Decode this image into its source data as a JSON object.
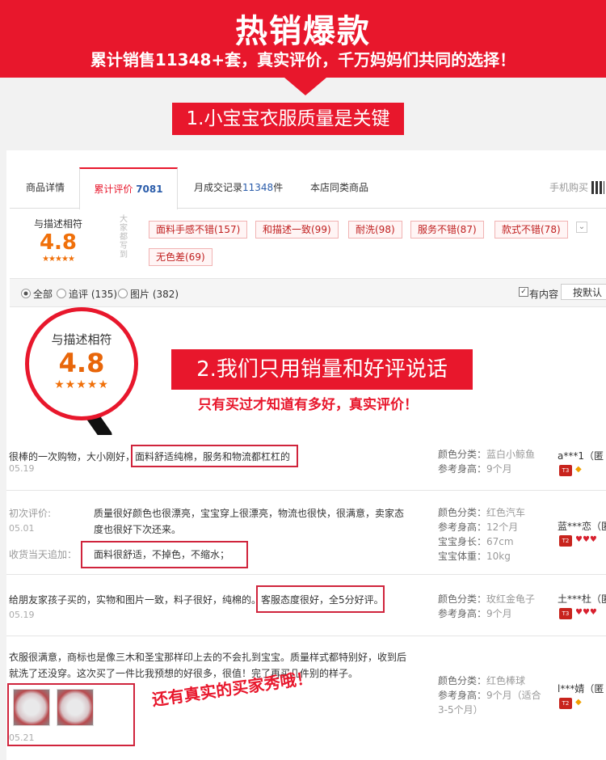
{
  "banner": {
    "title": "热销爆款",
    "subtitle": "累计销售11348+套，真实评价，千万妈妈们共同的选择！"
  },
  "section1": {
    "label": "1.小宝宝衣服质量是关键"
  },
  "tabs": [
    {
      "label": "商品详情"
    },
    {
      "label": "累计评价 ",
      "count": "7081"
    },
    {
      "label": "月成交记录",
      "count": "11348",
      "suffix": "件"
    },
    {
      "label": "本店同类商品"
    },
    {
      "label": "手机购买"
    }
  ],
  "rating": {
    "label": "与描述相符",
    "score": "4.8",
    "stars": "★★★★★"
  },
  "impressions_label": "大家都写到",
  "tags": [
    "面料手感不错(157)",
    "和描述一致(99)",
    "耐洗(98)",
    "服务不错(87)",
    "款式不错(78)",
    "无色差(69)"
  ],
  "filter": {
    "all": "全部",
    "followup": "追评 (135)",
    "pics": "图片 (382)",
    "has_content": "有内容",
    "sort": "按默认"
  },
  "badge": {
    "label": "与描述相符",
    "score": "4.8",
    "stars": "★★★★★"
  },
  "section2": {
    "label": "2.我们只用销量和好评说话",
    "sub": "只有买过才知道有多好，真实评价！"
  },
  "reviews": [
    {
      "text_a": "很棒的一次购物，大小刚好，",
      "text_highlight": "面料舒适纯棉，服务和物流都杠杠的",
      "date": "05.19",
      "meta": [
        [
          "颜色分类：",
          "蓝白小鲸鱼"
        ],
        [
          "参考身高：",
          "9个月"
        ]
      ],
      "user": "a***1（匿",
      "level": "T3"
    },
    {
      "initial_label": "初次评价:",
      "initial_date": "05.01",
      "text": "质量很好颜色也很漂亮，宝宝穿上很漂亮，物流也很快，很满意，卖家态度也很好下次还来。",
      "append_label": "收货当天追加：",
      "append_text": "面料很舒适，不掉色，不缩水；",
      "meta": [
        [
          "颜色分类：",
          "红色汽车"
        ],
        [
          "参考身高：",
          "12个月"
        ],
        [
          "宝宝身长：",
          "67cm"
        ],
        [
          "宝宝体重：",
          "10kg"
        ]
      ],
      "user": "蓝***恋（匿",
      "level": "T2"
    },
    {
      "text_a": "给朋友家孩子买的，实物和图片一致，料子很好，纯棉的。",
      "text_highlight": "客服态度很好，全5分好评。",
      "date": "05.19",
      "meta": [
        [
          "颜色分类：",
          "玫红金龟子"
        ],
        [
          "参考身高：",
          "9个月"
        ]
      ],
      "user": "土***杜（匿",
      "level": "T3"
    },
    {
      "text": "衣服很满意，商标也是像三木和圣宝那样印上去的不会扎到宝宝。质量样式都特别好，收到后就洗了还没穿。这次买了一件比我预想的好很多，很值！完了再买几件别的样子。",
      "date": "05.21",
      "meta": [
        [
          "颜色分类：",
          "红色棒球"
        ],
        [
          "参考身高：",
          "9个月（适合3-5个月）"
        ]
      ],
      "user": "l***婧（匿",
      "level": "T2"
    }
  ],
  "buyer_show": "还有真实的买家秀哦！",
  "colors": {
    "brand_red": "#e8172c",
    "score_orange": "#f0700a",
    "link_blue": "#2a5caa"
  }
}
